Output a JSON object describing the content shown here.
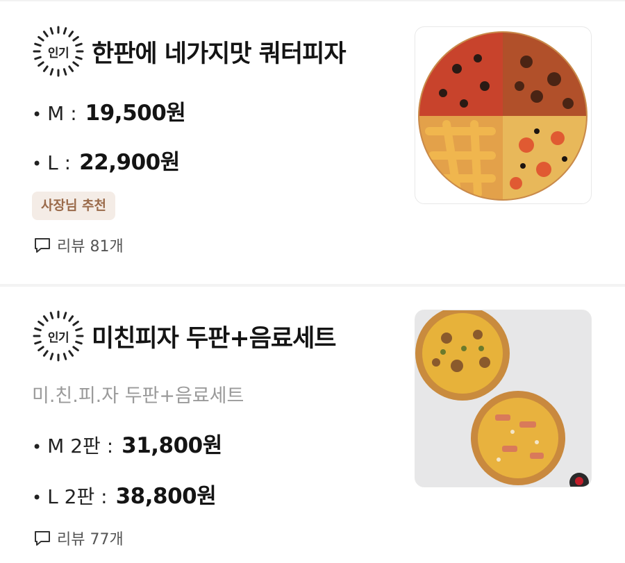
{
  "menu_items": [
    {
      "badge": "인기",
      "title": "한판에 네가지맛 쿼터피자",
      "prices": [
        {
          "size": "M :",
          "price": "19,500원"
        },
        {
          "size": "L :",
          "price": "22,900원"
        }
      ],
      "tag": "사장님 추천",
      "review": "리뷰 81개",
      "image_icon": "quarter-pizza-photo"
    },
    {
      "badge": "인기",
      "title": "미친피자 두판+음료세트",
      "subtitle": "미.친.피.자 두판+음료세트",
      "prices": [
        {
          "size": "M 2판 :",
          "price": "31,800원"
        },
        {
          "size": "L 2판 :",
          "price": "38,800원"
        }
      ],
      "review": "리뷰 77개",
      "image_icon": "two-pizzas-photo"
    }
  ],
  "colors": {
    "tag_bg": "#f4ece6",
    "tag_text": "#9a6a4a",
    "subtitle": "#9a9a9a",
    "review_text": "#555555"
  }
}
